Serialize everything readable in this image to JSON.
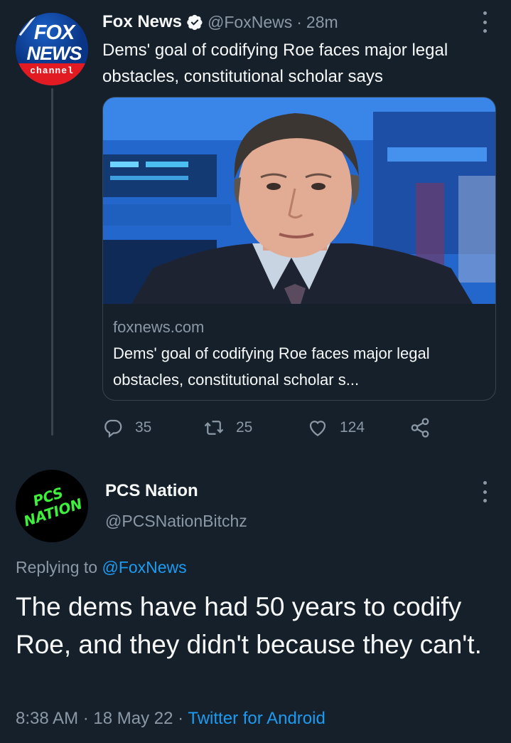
{
  "original_tweet": {
    "author_name": "Fox News",
    "handle": "@FoxNews",
    "separator": "·",
    "time": "28m",
    "text": "Dems' goal of codifying Roe faces major legal obstacles, constitutional scholar says",
    "avatar": {
      "line1": "FOX",
      "line2": "NEWS",
      "line3": "channel"
    },
    "card": {
      "domain": "foxnews.com",
      "title": "Dems' goal of codifying Roe faces major legal obstacles, constitutional scholar s..."
    },
    "actions": {
      "replies": "35",
      "retweets": "25",
      "likes": "124"
    }
  },
  "reply_tweet": {
    "author_name": "PCS Nation",
    "handle": "@PCSNationBitchz",
    "avatar": {
      "line1": "PCS",
      "line2": "NATION"
    },
    "replying_prefix": "Replying to",
    "replying_to": "@FoxNews",
    "text": "The dems have had 50 years to codify Roe, and they didn't because they can't.",
    "time": "8:38 AM",
    "dot1": "·",
    "date": "18 May 22",
    "dot2": "·",
    "source": "Twitter for Android"
  },
  "colors": {
    "background": "#15202b",
    "secondary_text": "#8b98a5",
    "accent": "#1d9bf0",
    "border": "#38444d"
  },
  "icons": [
    "verified-badge-icon",
    "more-icon",
    "reply-icon",
    "retweet-icon",
    "like-icon",
    "share-icon"
  ]
}
